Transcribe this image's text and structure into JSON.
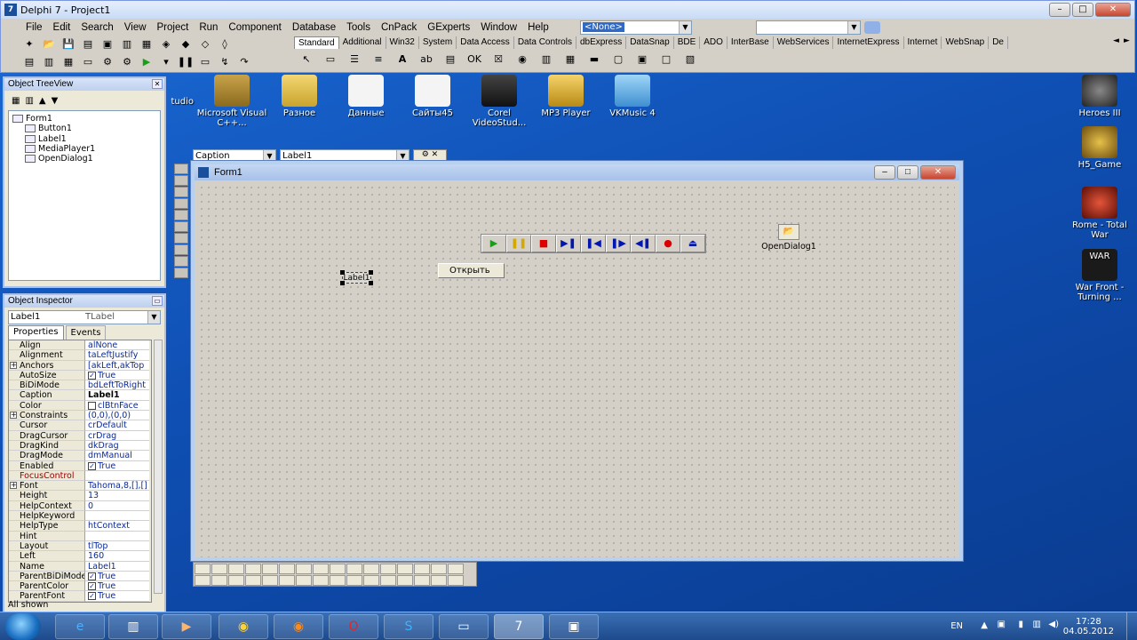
{
  "ide": {
    "title": "Delphi 7 - Project1",
    "menu": [
      "File",
      "Edit",
      "Search",
      "View",
      "Project",
      "Run",
      "Component",
      "Database",
      "Tools",
      "CnPack",
      "GExperts",
      "Window",
      "Help"
    ],
    "config_combo": "<None>",
    "search_combo": "",
    "palette_tabs": [
      "Standard",
      "Additional",
      "Win32",
      "System",
      "Data Access",
      "Data Controls",
      "dbExpress",
      "DataSnap",
      "BDE",
      "ADO",
      "InterBase",
      "WebServices",
      "InternetExpress",
      "Internet",
      "WebSnap",
      "De"
    ],
    "active_tab": "Standard"
  },
  "object_treeview": {
    "title": "Object TreeView",
    "root": "Form1",
    "children": [
      "Button1",
      "Label1",
      "MediaPlayer1",
      "OpenDialog1"
    ]
  },
  "object_inspector": {
    "title": "Object Inspector",
    "selected_object": "Label1",
    "selected_type": "TLabel",
    "tabs": [
      "Properties",
      "Events"
    ],
    "properties": [
      {
        "name": "Align",
        "value": "alNone"
      },
      {
        "name": "Alignment",
        "value": "taLeftJustify"
      },
      {
        "name": "Anchors",
        "value": "[akLeft,akTop"
      },
      {
        "name": "AutoSize",
        "value": "True"
      },
      {
        "name": "BiDiMode",
        "value": "bdLeftToRight"
      },
      {
        "name": "Caption",
        "value": "Label1"
      },
      {
        "name": "Color",
        "value": "clBtnFace"
      },
      {
        "name": "Constraints",
        "value": "(0,0),(0,0)"
      },
      {
        "name": "Cursor",
        "value": "crDefault"
      },
      {
        "name": "DragCursor",
        "value": "crDrag"
      },
      {
        "name": "DragKind",
        "value": "dkDrag"
      },
      {
        "name": "DragMode",
        "value": "dmManual"
      },
      {
        "name": "Enabled",
        "value": "True"
      },
      {
        "name": "FocusControl",
        "value": ""
      },
      {
        "name": "Font",
        "value": "Tahoma,8,[],[]"
      },
      {
        "name": "Height",
        "value": "13"
      },
      {
        "name": "HelpContext",
        "value": "0"
      },
      {
        "name": "HelpKeyword",
        "value": ""
      },
      {
        "name": "HelpType",
        "value": "htContext"
      },
      {
        "name": "Hint",
        "value": ""
      },
      {
        "name": "Layout",
        "value": "tlTop"
      },
      {
        "name": "Left",
        "value": "160"
      },
      {
        "name": "Name",
        "value": "Label1"
      },
      {
        "name": "ParentBiDiMode",
        "value": "True"
      },
      {
        "name": "ParentColor",
        "value": "True"
      },
      {
        "name": "ParentFont",
        "value": "True"
      }
    ],
    "status": "All shown"
  },
  "property_combos": {
    "property": "Caption",
    "component": "Label1"
  },
  "form": {
    "title": "Form1",
    "button_caption": "Открыть",
    "label_caption": "Label1",
    "opendialog_caption": "OpenDialog1"
  },
  "desktop_icons": [
    "Microsoft Visual C++...",
    "Разное",
    "Данные",
    "Сайты45",
    "Corel VideoStud...",
    "MP3 Player",
    "VKMusic 4",
    "Heroes III",
    "H5_Game",
    "Rome - Total War",
    "War Front - Turning ...",
    "tudio"
  ],
  "taskbar": {
    "lang": "EN",
    "time": "17:28",
    "date": "04.05.2012"
  }
}
